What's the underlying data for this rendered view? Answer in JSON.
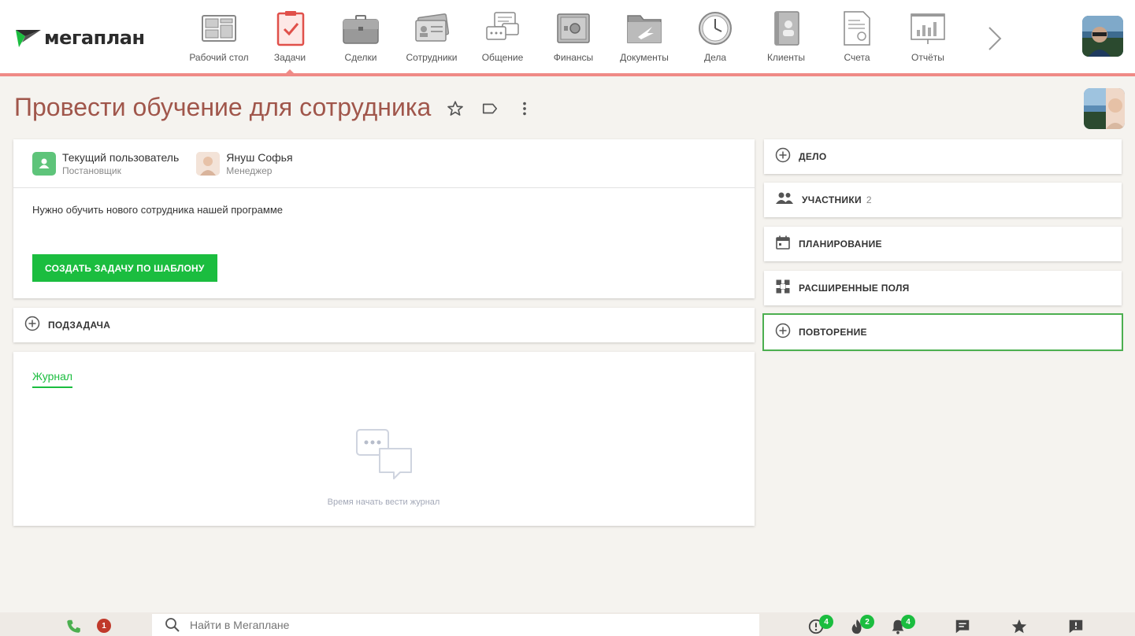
{
  "app": {
    "logo_text": "мегаплан"
  },
  "nav": {
    "items": [
      {
        "label": "Рабочий стол",
        "icon": "desktop-icon"
      },
      {
        "label": "Задачи",
        "icon": "tasks-icon",
        "active": true
      },
      {
        "label": "Сделки",
        "icon": "briefcase-icon"
      },
      {
        "label": "Сотрудники",
        "icon": "employees-icon"
      },
      {
        "label": "Общение",
        "icon": "chat-icon"
      },
      {
        "label": "Финансы",
        "icon": "safe-icon"
      },
      {
        "label": "Документы",
        "icon": "folder-icon"
      },
      {
        "label": "Дела",
        "icon": "clock-icon"
      },
      {
        "label": "Клиенты",
        "icon": "contacts-book-icon"
      },
      {
        "label": "Счета",
        "icon": "invoice-icon"
      },
      {
        "label": "Отчёты",
        "icon": "report-chart-icon"
      }
    ]
  },
  "task": {
    "title": "Провести обучение для сотрудника",
    "people": [
      {
        "name": "Текущий пользователь",
        "role": "Постановщик"
      },
      {
        "name": "Януш Софья",
        "role": "Менеджер"
      }
    ],
    "description": "Нужно обучить нового сотрудника нашей программе",
    "template_button": "СОЗДАТЬ ЗАДАЧУ ПО ШАБЛОНУ",
    "subtask_label": "ПОДЗАДАЧА",
    "journal_tab": "Журнал",
    "journal_empty": "Время начать вести журнал"
  },
  "sidebar": {
    "items": [
      {
        "label": "ДЕЛО",
        "icon": "plus-circle-icon",
        "count": ""
      },
      {
        "label": "УЧАСТНИКИ",
        "icon": "people-icon",
        "count": "2"
      },
      {
        "label": "ПЛАНИРОВАНИЕ",
        "icon": "calendar-icon",
        "count": ""
      },
      {
        "label": "РАСШИРЕННЫЕ ПОЛЯ",
        "icon": "extended-fields-icon",
        "count": ""
      },
      {
        "label": "ПОВТОРЕНИЕ",
        "icon": "plus-circle-icon",
        "count": "",
        "highlighted": true
      }
    ]
  },
  "bottombar": {
    "search_placeholder": "Найти в Мегаплане",
    "phone_badge": "1",
    "alerts_badge": "4",
    "hot_badge": "2",
    "notifications_badge": "4"
  },
  "colors": {
    "accent_red": "#ef8a86",
    "title": "#a0564b",
    "green": "#1bbd3f",
    "badge_red": "#c0392b"
  }
}
